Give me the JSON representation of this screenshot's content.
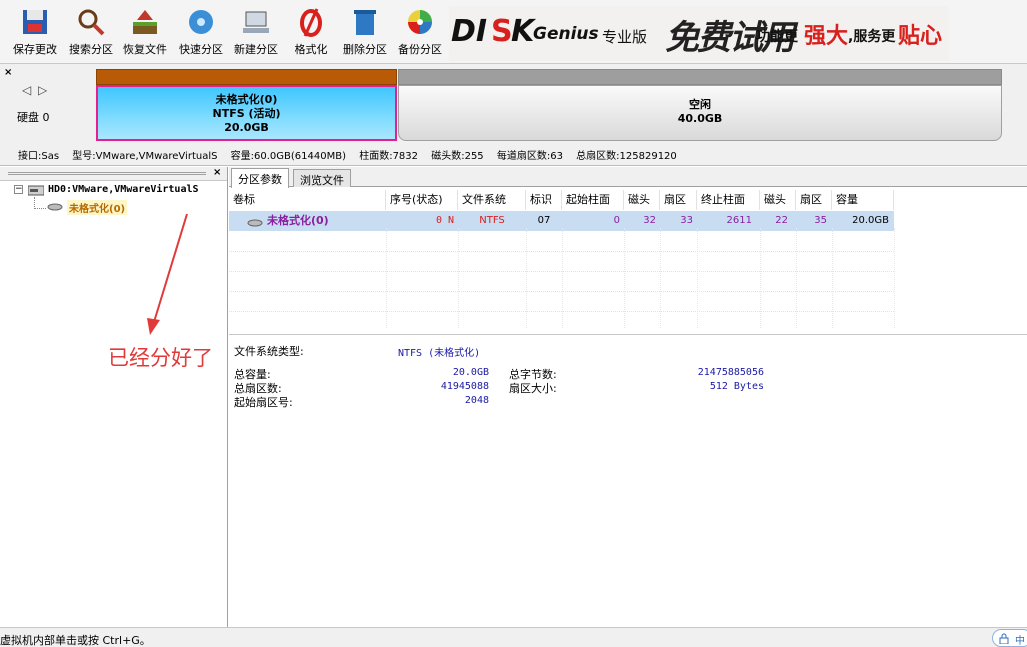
{
  "toolbar": {
    "buttons": [
      {
        "label": "保存更改",
        "icon": "save-icon"
      },
      {
        "label": "搜索分区",
        "icon": "search-icon"
      },
      {
        "label": "恢复文件",
        "icon": "recover-icon"
      },
      {
        "label": "快速分区",
        "icon": "quick-partition-icon"
      },
      {
        "label": "新建分区",
        "icon": "new-partition-icon"
      },
      {
        "label": "格式化",
        "icon": "format-icon"
      },
      {
        "label": "删除分区",
        "icon": "delete-icon"
      },
      {
        "label": "备份分区",
        "icon": "backup-icon"
      }
    ],
    "banner": {
      "brand_a": "DI",
      "brand_b": "K",
      "brand_c": "Genius",
      "edition": "专业版",
      "trial": "免费试用",
      "slogan_a": "功能更",
      "slogan_b": "强大",
      "slogan_c": ",服务更",
      "slogan_d": "贴心"
    }
  },
  "disk": {
    "label": "硬盘 0",
    "active_partition": {
      "line1": "未格式化(0)",
      "line2": "NTFS (活动)",
      "line3": "20.0GB"
    },
    "free_space": {
      "line1": "空闲",
      "line2": "40.0GB"
    },
    "info": {
      "interface": "接口:Sas",
      "model": "型号:VMware,VMwareVirtualS",
      "capacity": "容量:60.0GB(61440MB)",
      "cylinders": "柱面数:7832",
      "heads": "磁头数:255",
      "sectors_per_track": "每道扇区数:63",
      "total_sectors": "总扇区数:125829120"
    }
  },
  "tree": {
    "disk_node": "HD0:VMware,VMwareVirtualS",
    "partition_node": "未格式化(0)"
  },
  "tabs": [
    "分区参数",
    "浏览文件"
  ],
  "table": {
    "headers": [
      "卷标",
      "序号(状态)",
      "文件系统",
      "标识",
      "起始柱面",
      "磁头",
      "扇区",
      "终止柱面",
      "磁头",
      "扇区",
      "容量"
    ],
    "row": [
      "未格式化(0)",
      "0 N",
      "NTFS",
      "07",
      "0",
      "32",
      "33",
      "2611",
      "22",
      "35",
      "20.0GB"
    ]
  },
  "details": {
    "fs_type_label": "文件系统类型:",
    "fs_type_value": "NTFS (未格式化)",
    "total_capacity_label": "总容量:",
    "total_capacity_value": "20.0GB",
    "total_bytes_label": "总字节数:",
    "total_bytes_value": "21475885056",
    "total_sectors_label": "总扇区数:",
    "total_sectors_value": "41945088",
    "sector_size_label": "扇区大小:",
    "sector_size_value": "512 Bytes",
    "start_sector_label": "起始扇区号:",
    "start_sector_value": "2048"
  },
  "annotation": "已经分好了",
  "status": "虚拟机内部单击或按 Ctrl+G。",
  "ime": "中",
  "colors": {
    "accent_magenta": "#e51f8b",
    "partition_blue": "#3fc6ff",
    "partition_bar_brown": "#b85a06",
    "annotation_red": "#e03a3a",
    "value_blue": "#1a1aa6",
    "row_purple": "#8a1fa0"
  }
}
